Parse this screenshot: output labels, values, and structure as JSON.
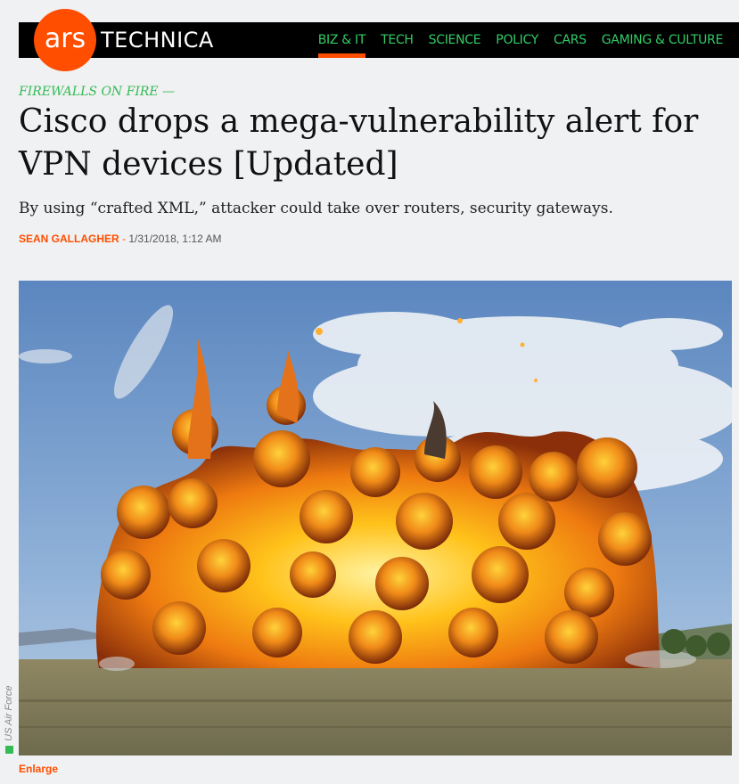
{
  "site": {
    "logo_ars": "ars",
    "logo_technica": "TECHNICA",
    "colors": {
      "brand": "#ff4e00",
      "nav": "#33cc66",
      "kicker": "#33bb55"
    }
  },
  "nav": {
    "items": [
      {
        "label": "BIZ & IT",
        "active": true
      },
      {
        "label": "TECH",
        "active": false
      },
      {
        "label": "SCIENCE",
        "active": false
      },
      {
        "label": "POLICY",
        "active": false
      },
      {
        "label": "CARS",
        "active": false
      },
      {
        "label": "GAMING & CULTURE",
        "active": false
      }
    ]
  },
  "article": {
    "kicker": "FIREWALLS ON FIRE —",
    "headline": "Cisco drops a mega-vulnerability alert for VPN devices [Updated]",
    "dek": "By using “crafted XML,” attacker could take over routers, security gateways.",
    "author": "SEAN GALLAGHER",
    "separator": "-",
    "date": "1/31/2018, 1:12 AM",
    "image_credit": "US Air Force",
    "enlarge_label": "Enlarge"
  }
}
